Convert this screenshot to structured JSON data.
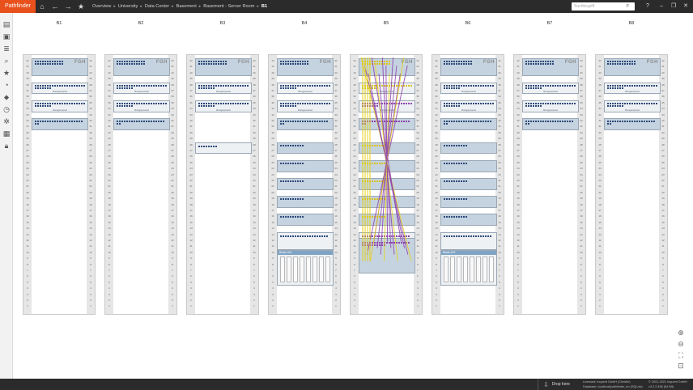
{
  "app": {
    "brand": "Pathfinder"
  },
  "breadcrumb": [
    "Overview",
    "University",
    "Data Center",
    "Basement",
    "Basement - Server Room",
    "B1"
  ],
  "search": {
    "placeholder": "Suchbegriff"
  },
  "window_controls": [
    "?",
    "–",
    "❐",
    "✕"
  ],
  "topbar_icons": [
    "home-icon",
    "back-icon",
    "forward-icon",
    "favorite-add-icon"
  ],
  "left_toolbar_icons": [
    "rack-layout-icon",
    "devices-icon",
    "layers-icon",
    "search-icon",
    "star-icon",
    "pie-chart-icon",
    "tag-icon",
    "history-icon",
    "network-icon",
    "fields-icon",
    "lock-icon"
  ],
  "racks": [
    {
      "name": "B1"
    },
    {
      "name": "B2"
    },
    {
      "name": "B3"
    },
    {
      "name": "B4"
    },
    {
      "name": "B5"
    },
    {
      "name": "B6"
    },
    {
      "name": "B7"
    },
    {
      "name": "B8"
    }
  ],
  "unit_numbers": [
    42,
    41,
    40,
    39,
    38,
    37,
    36,
    35,
    34,
    33,
    32,
    31,
    30,
    29,
    28,
    27,
    26,
    25,
    24,
    23,
    22,
    21,
    20,
    19,
    18,
    17,
    16,
    15,
    14,
    13,
    12,
    11,
    10,
    9,
    8,
    7,
    6,
    5,
    4,
    3,
    2,
    1
  ],
  "devices": {
    "patch_panel_label": "Rangierpanel",
    "fgh_label": "FGH",
    "blade_b4": "Blade-001",
    "blade_b6": "Blade-002"
  },
  "zoom": [
    "zoom-in-icon",
    "zoom-out-icon",
    "fit-icon",
    "reset-icon"
  ],
  "status": {
    "drop_label": "Drop here",
    "license": "Licensed: Inquent GmbH (Christin)",
    "database": "Database: localhost\\pathfinder_en (SQL/ss)",
    "copyright": "© 2001-2021 Inquent GmbH",
    "version": "v3.2.2.456 (64 Bit)"
  },
  "colors": {
    "brand": "#e8501c",
    "topbar": "#2b2b2b",
    "cable_purple": "#8e44ad",
    "cable_yellow": "#e5d21a"
  }
}
